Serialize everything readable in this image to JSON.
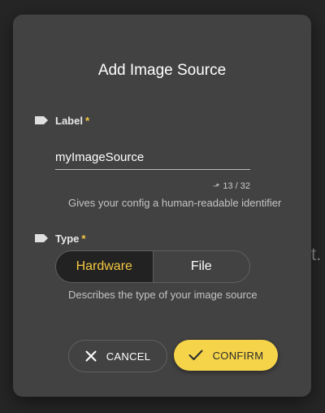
{
  "backdrop": {
    "partial_text": "t."
  },
  "dialog": {
    "title": "Add Image Source",
    "label_field": {
      "label": "Label",
      "required_mark": "*",
      "value": "myImageSource",
      "counter_prefix": "⬏",
      "counter": "13 / 32",
      "hint": "Gives your config a human-readable identifier"
    },
    "type_field": {
      "label": "Type",
      "required_mark": "*",
      "options": [
        "Hardware",
        "File"
      ],
      "selected": "Hardware",
      "hint": "Describes the type of your image source"
    },
    "actions": {
      "cancel_label": "CANCEL",
      "confirm_label": "CONFIRM"
    }
  },
  "icons": {
    "label_field_icon": "label-icon",
    "type_field_icon": "label-icon",
    "cancel_icon": "close-icon",
    "confirm_icon": "check-icon"
  },
  "colors": {
    "accent": "#f5d44a",
    "dialog_bg": "#424242",
    "backdrop_bg": "#262626"
  }
}
